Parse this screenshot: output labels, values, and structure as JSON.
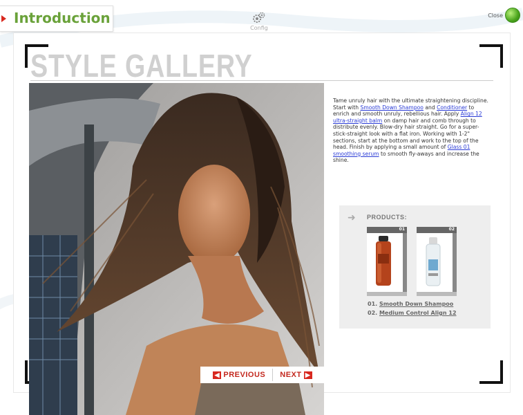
{
  "header": {
    "tab_label": "Introduction",
    "config_label": "Config",
    "close_label": "Close"
  },
  "gallery": {
    "title": "STYLE GALLERY",
    "description": {
      "t1": "Tame unruly hair with the ultimate straightening discipline. Start with ",
      "l1": "Smooth Down Shampoo",
      "t2": " and ",
      "l2": "Conditioner",
      "t3": " to enrich and smooth unruly, rebellious hair. Apply ",
      "l3": "Align 12 ultra-straight balm",
      "t4": " on damp hair and comb through to distribute evenly. Blow-dry hair straight. Go for a super-stick-straight look with a flat iron. Working with 1-2\" sections, start at the bottom and work to the top of the head. Finish by applying a small amount of ",
      "l4": "Glass 01 smoothing serum",
      "t5": " to smooth fly-aways and increase the shine."
    },
    "products": {
      "heading": "PRODUCTS:",
      "items": [
        {
          "number": "01",
          "prefix": "01.",
          "name": "Smooth Down Shampoo"
        },
        {
          "number": "02",
          "prefix": "02.",
          "name": "Medium Control Align 12"
        }
      ]
    },
    "nav": {
      "previous": "PREVIOUS",
      "next": "NEXT"
    }
  },
  "colors": {
    "accent_green": "#6aa23a",
    "accent_red": "#d8281f",
    "link_blue": "#2a3bd6"
  }
}
